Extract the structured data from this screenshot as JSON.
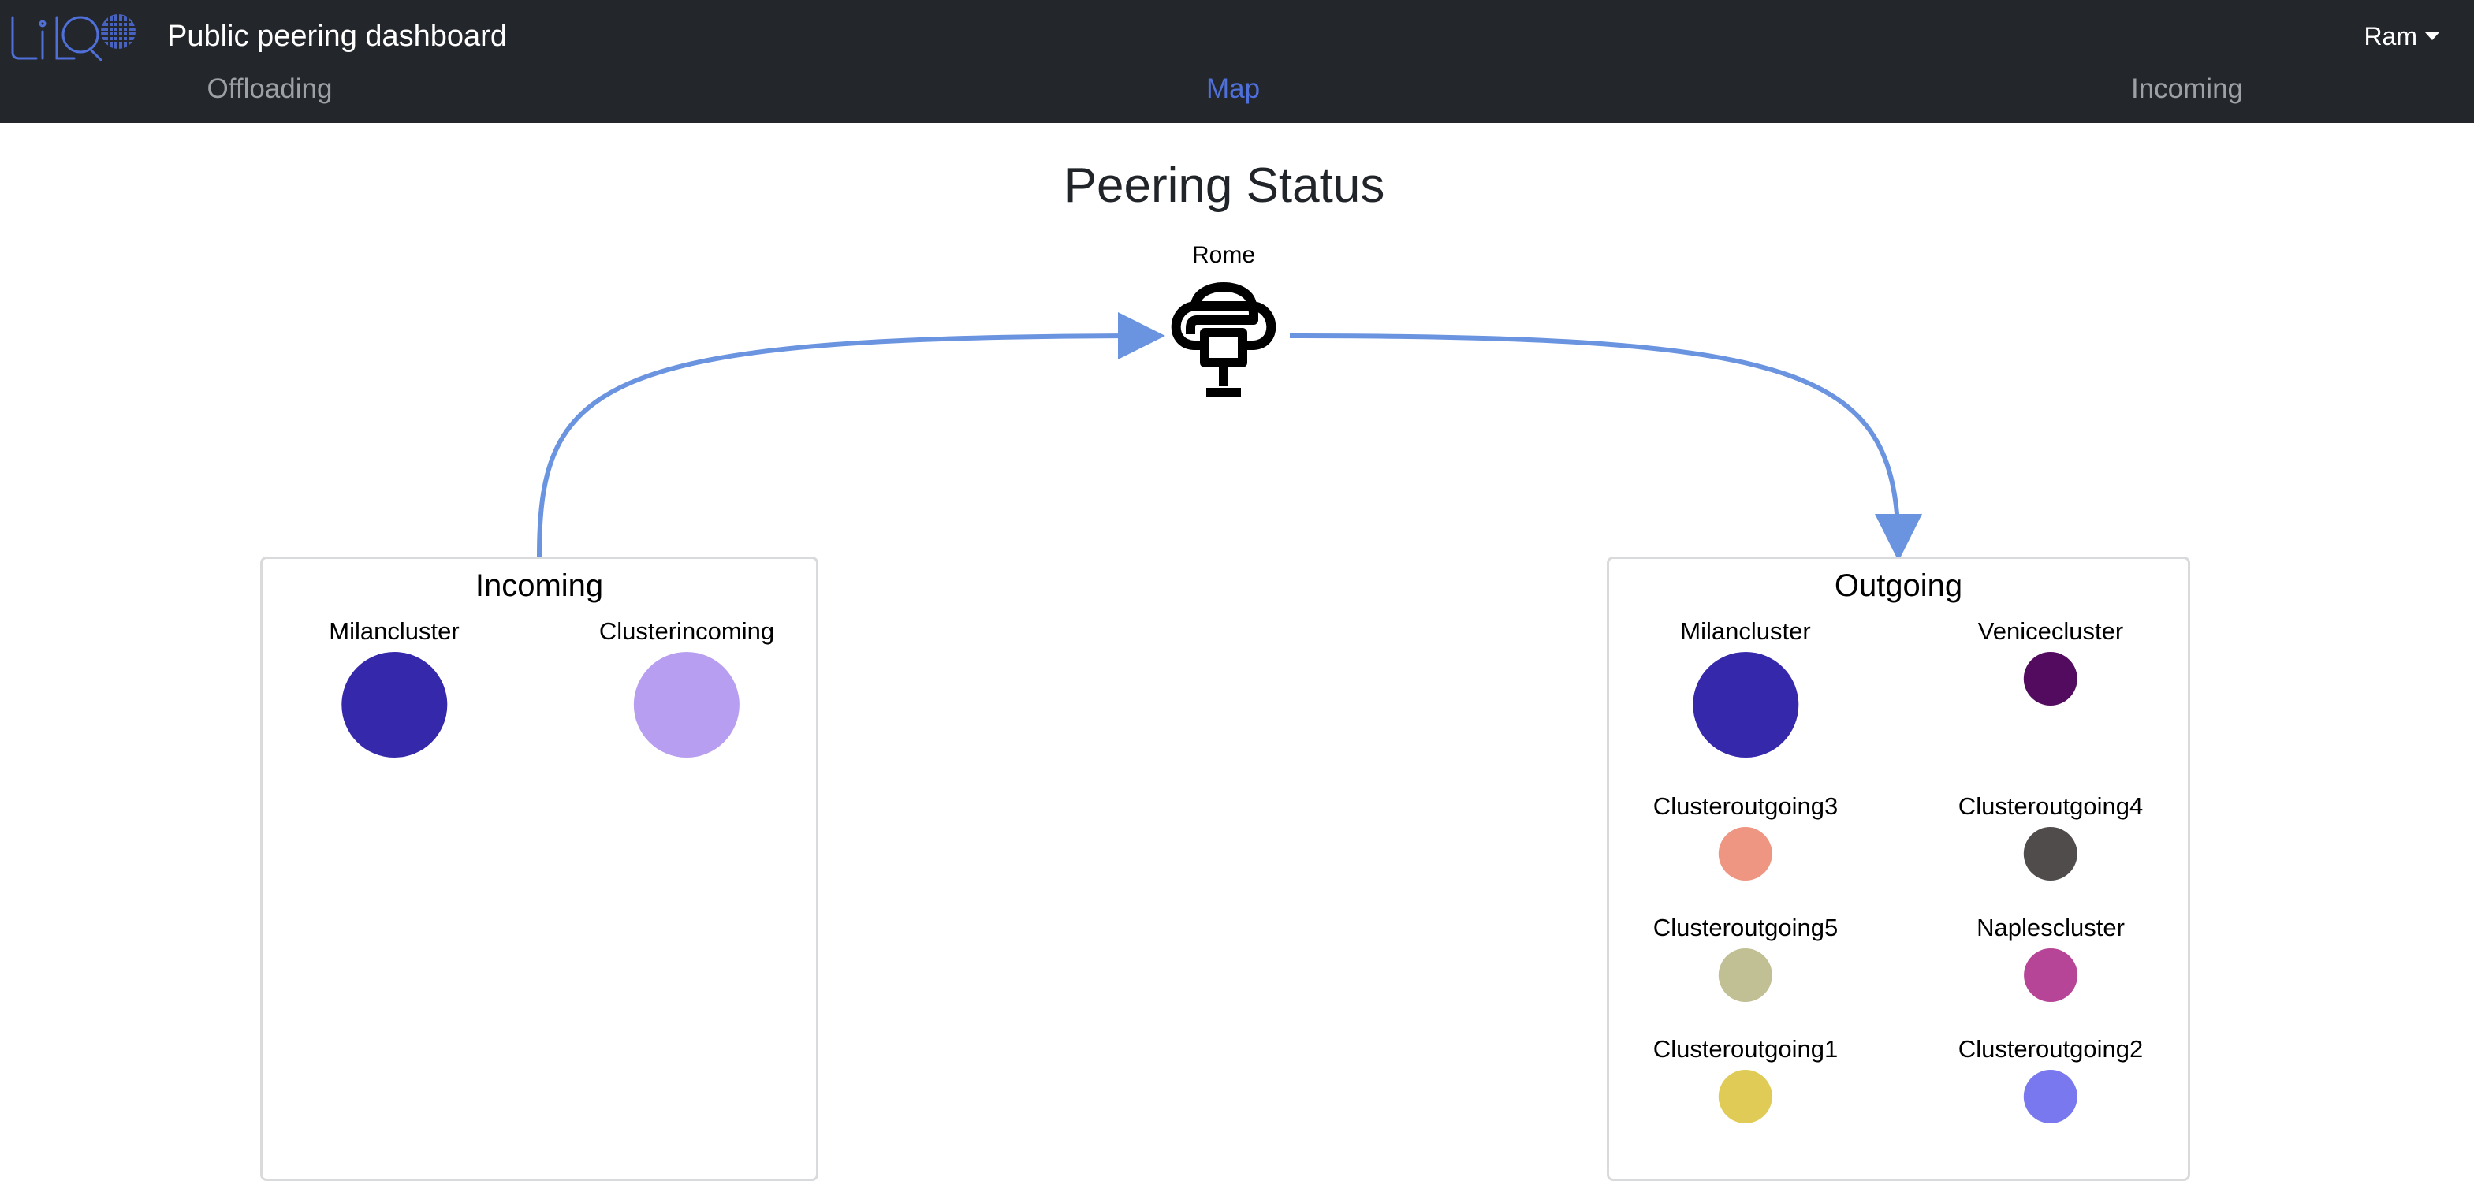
{
  "header": {
    "app_title": "Public peering dashboard",
    "user_name": "Ram",
    "logo_icon": "liqo-logo"
  },
  "nav": {
    "tabs": [
      {
        "label": "Offloading",
        "active": false
      },
      {
        "label": "Map",
        "active": true
      },
      {
        "label": "Incoming",
        "active": false
      }
    ],
    "active_color": "#4f6fd9"
  },
  "main": {
    "title": "Peering Status",
    "center_cluster": {
      "label": "Rome",
      "icon": "cluster-network-icon"
    },
    "edge_color": "#6a93e0"
  },
  "incoming": {
    "title": "Incoming",
    "clusters": [
      {
        "label": "Milancluster",
        "color": "#3528aa"
      },
      {
        "label": "Clusterincoming",
        "color": "#b89ef0"
      }
    ]
  },
  "outgoing": {
    "title": "Outgoing",
    "clusters": [
      {
        "label": "Milancluster",
        "color": "#3528aa"
      },
      {
        "label": "Venicecluster",
        "color": "#530b5f"
      },
      {
        "label": "Clusteroutgoing3",
        "color": "#ee9682"
      },
      {
        "label": "Clusteroutgoing4",
        "color": "#504c4b"
      },
      {
        "label": "Clusteroutgoing5",
        "color": "#c1c094"
      },
      {
        "label": "Naplescluster",
        "color": "#b74597"
      },
      {
        "label": "Clusteroutgoing1",
        "color": "#dfcb56"
      },
      {
        "label": "Clusteroutgoing2",
        "color": "#7a78ee"
      }
    ]
  }
}
